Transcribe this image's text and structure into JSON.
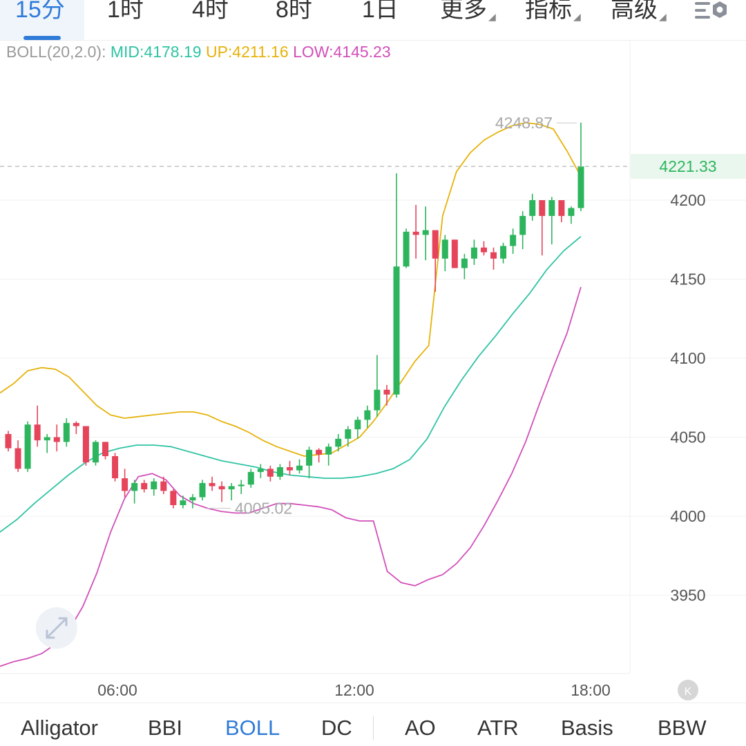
{
  "timeframe_tabs": [
    {
      "label": "15分",
      "active": true
    },
    {
      "label": "1时"
    },
    {
      "label": "4时"
    },
    {
      "label": "8时"
    },
    {
      "label": "1日"
    },
    {
      "label": "更多",
      "dropdown": true
    },
    {
      "label": "指标",
      "dropdown": true
    },
    {
      "label": "高级",
      "dropdown": true
    }
  ],
  "settings_icon": "settings-sliders-icon",
  "indicator_legend": {
    "name": "BOLL(20,2.0):",
    "mid": "MID:4178.19",
    "up": "UP:4211.16",
    "low": "LOW:4145.23"
  },
  "colors": {
    "bull": "#2db55d",
    "bear": "#e5445a",
    "mid_band": "#2fc3a4",
    "up_band": "#e6b20a",
    "low_band": "#d14fb9",
    "accent": "#2f7bd8"
  },
  "chart_data": {
    "type": "candlestick",
    "y_ticks": [
      "4200",
      "4150",
      "4100",
      "4050",
      "4000",
      "3950"
    ],
    "ylim": [
      3900,
      4270
    ],
    "x_ticks": [
      "06:00",
      "12:00",
      "18:00"
    ],
    "current_price": "4221.33",
    "high_marker": "4248.87",
    "low_marker": "4005.02",
    "candles": [
      [
        4052,
        4054,
        4041,
        4043
      ],
      [
        4043,
        4048,
        4028,
        4030
      ],
      [
        4030,
        4060,
        4028,
        4058
      ],
      [
        4058,
        4070,
        4044,
        4048
      ],
      [
        4048,
        4052,
        4040,
        4050
      ],
      [
        4050,
        4058,
        4041,
        4047
      ],
      [
        4047,
        4062,
        4044,
        4059
      ],
      [
        4059,
        4060,
        4052,
        4057
      ],
      [
        4057,
        4057,
        4032,
        4034
      ],
      [
        4034,
        4048,
        4032,
        4047
      ],
      [
        4047,
        4047,
        4036,
        4038
      ],
      [
        4038,
        4040,
        4022,
        4024
      ],
      [
        4024,
        4030,
        4012,
        4016
      ],
      [
        4016,
        4023,
        4008,
        4021
      ],
      [
        4021,
        4023,
        4015,
        4017
      ],
      [
        4017,
        4024,
        4013,
        4022
      ],
      [
        4022,
        4025,
        4014,
        4016
      ],
      [
        4016,
        4017,
        4005,
        4007
      ],
      [
        4007,
        4013,
        4005,
        4010
      ],
      [
        4010,
        4014,
        4005,
        4012
      ],
      [
        4012,
        4023,
        4010,
        4021
      ],
      [
        4021,
        4025,
        4016,
        4019
      ],
      [
        4019,
        4022,
        4009,
        4017
      ],
      [
        4017,
        4021,
        4010,
        4019
      ],
      [
        4019,
        4023,
        4014,
        4020
      ],
      [
        4020,
        4030,
        4018,
        4028
      ],
      [
        4028,
        4033,
        4024,
        4030
      ],
      [
        4030,
        4032,
        4022,
        4025
      ],
      [
        4025,
        4033,
        4023,
        4031
      ],
      [
        4031,
        4035,
        4026,
        4029
      ],
      [
        4029,
        4036,
        4027,
        4032
      ],
      [
        4032,
        4044,
        4024,
        4042
      ],
      [
        4042,
        4043,
        4034,
        4039
      ],
      [
        4039,
        4046,
        4032,
        4044
      ],
      [
        4044,
        4052,
        4041,
        4049
      ],
      [
        4049,
        4057,
        4044,
        4055
      ],
      [
        4055,
        4063,
        4049,
        4061
      ],
      [
        4061,
        4070,
        4056,
        4067
      ],
      [
        4067,
        4102,
        4063,
        4080
      ],
      [
        4080,
        4083,
        4070,
        4077
      ],
      [
        4077,
        4217,
        4075,
        4158
      ],
      [
        4158,
        4182,
        4157,
        4180
      ],
      [
        4180,
        4197,
        4163,
        4178
      ],
      [
        4178,
        4196,
        4162,
        4181
      ],
      [
        4181,
        4181,
        4142,
        4163
      ],
      [
        4163,
        4178,
        4155,
        4175
      ],
      [
        4175,
        4175,
        4157,
        4157
      ],
      [
        4157,
        4166,
        4150,
        4163
      ],
      [
        4163,
        4175,
        4159,
        4170
      ],
      [
        4170,
        4174,
        4165,
        4167
      ],
      [
        4167,
        4170,
        4156,
        4163
      ],
      [
        4163,
        4173,
        4160,
        4171
      ],
      [
        4171,
        4182,
        4166,
        4178
      ],
      [
        4178,
        4193,
        4169,
        4190
      ],
      [
        4190,
        4204,
        4187,
        4200
      ],
      [
        4200,
        4200,
        4165,
        4190
      ],
      [
        4190,
        4202,
        4172,
        4200
      ],
      [
        4200,
        4200,
        4186,
        4190
      ],
      [
        4190,
        4196,
        4185,
        4195
      ],
      [
        4195,
        4249,
        4193,
        4221.33
      ]
    ],
    "up_band": [
      4078,
      4084,
      4092,
      4094,
      4093,
      4088,
      4079,
      4070,
      4064,
      4062,
      4063,
      4064,
      4065,
      4066,
      4066,
      4064,
      4060,
      4057,
      4053,
      4048,
      4044,
      4041,
      4038,
      4039,
      4040,
      4045,
      4050,
      4060,
      4072,
      4085,
      4098,
      4108,
      4190,
      4218,
      4230,
      4238,
      4243,
      4247,
      4249,
      4248,
      4245,
      4231,
      4215
    ],
    "mid_band": [
      3990,
      3998,
      4008,
      4017,
      4026,
      4034,
      4040,
      4043,
      4045,
      4045,
      4044,
      4041,
      4038,
      4035,
      4033,
      4031,
      4028,
      4026,
      4025,
      4024,
      4024,
      4025,
      4027,
      4030,
      4036,
      4049,
      4069,
      4086,
      4101,
      4114,
      4128,
      4141,
      4156,
      4168,
      4177
    ],
    "low_band": [
      3905,
      3908,
      3910,
      3913,
      3919,
      3928,
      3943,
      3964,
      3990,
      4011,
      4025,
      4027,
      4023,
      4013,
      4008,
      4005,
      4003,
      4002,
      4002,
      4005,
      4008,
      4008,
      4007,
      4006,
      4004,
      3999,
      3997,
      3997,
      3965,
      3958,
      3956,
      3960,
      3963,
      3970,
      3980,
      3994,
      4010,
      4027,
      4047,
      4071,
      4094,
      4116,
      4145
    ]
  },
  "bottom_tabs": [
    {
      "label": "Alligator"
    },
    {
      "label": "BBI"
    },
    {
      "label": "BOLL",
      "active": true
    },
    {
      "label": "DC"
    },
    {
      "label": "AO"
    },
    {
      "label": "ATR"
    },
    {
      "label": "Basis"
    },
    {
      "label": "BBW"
    }
  ]
}
